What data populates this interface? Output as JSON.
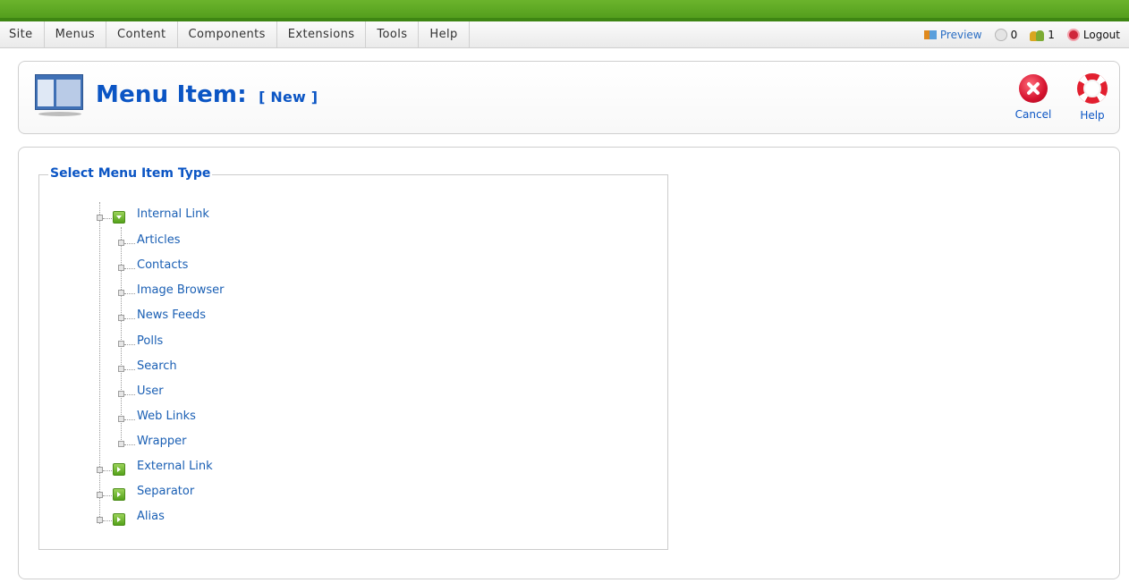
{
  "menubar": {
    "items": [
      "Site",
      "Menus",
      "Content",
      "Components",
      "Extensions",
      "Tools",
      "Help"
    ],
    "preview": "Preview",
    "messages_count": "0",
    "users_count": "1",
    "logout": "Logout"
  },
  "header": {
    "title": "Menu Item:",
    "subtitle": "[ New ]"
  },
  "toolbar": {
    "cancel_label": "Cancel",
    "help_label": "Help"
  },
  "main": {
    "legend": "Select Menu Item Type",
    "tree": {
      "internal_link": {
        "label": "Internal Link",
        "children": [
          "Articles",
          "Contacts",
          "Image Browser",
          "News Feeds",
          "Polls",
          "Search",
          "User",
          "Web Links",
          "Wrapper"
        ]
      },
      "external_link": "External Link",
      "separator": "Separator",
      "alias": "Alias"
    }
  },
  "colors": {
    "brand_blue": "#0b55c4",
    "link_blue": "#1a5fb4",
    "top_green": "#5aa620"
  }
}
